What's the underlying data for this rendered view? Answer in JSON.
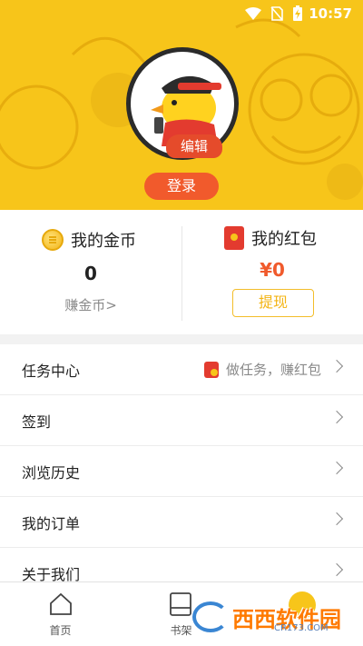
{
  "status_bar": {
    "time": "10:57"
  },
  "profile": {
    "edit_label": "编辑",
    "login_label": "登录"
  },
  "wallet": {
    "coins": {
      "title": "我的金币",
      "value": "0",
      "link": "赚金币>"
    },
    "red_packet": {
      "title": "我的红包",
      "value": "¥0",
      "withdraw_label": "提现"
    }
  },
  "menu": {
    "items": [
      {
        "label": "任务中心",
        "hint": "做任务，赚红包"
      },
      {
        "label": "签到"
      },
      {
        "label": "浏览历史"
      },
      {
        "label": "我的订单"
      },
      {
        "label": "关于我们"
      }
    ]
  },
  "bottom_nav": {
    "items": [
      {
        "label": "首页"
      },
      {
        "label": "书架"
      }
    ]
  },
  "watermark": {
    "text": "西西软件园",
    "sub": "CR173.COM"
  },
  "colors": {
    "header_bg": "#f7c51a",
    "accent_orange": "#f15a2c",
    "coin_gold": "#f3b414"
  }
}
